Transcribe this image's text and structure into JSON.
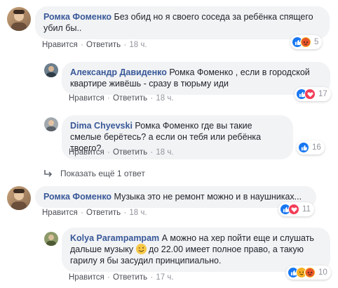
{
  "comments": [
    {
      "author": "Ромка Фоменко",
      "text": " Без обид но я своего соседа за ребёнка спящего убил бы..",
      "like": "Нравится",
      "reply": "Ответить",
      "time": "18 ч.",
      "reactions": {
        "icons": [
          "like-icon",
          "angry-icon"
        ],
        "count": "5"
      }
    },
    {
      "author": "Александр Давиденко",
      "text": " Ромка Фоменко , если в городской квартире живёшь - сразу в тюрьму иди",
      "like": "Нравится",
      "reply": "Ответить",
      "time": "18 ч.",
      "reactions": {
        "icons": [
          "like-icon",
          "love-icon"
        ],
        "count": "17"
      }
    },
    {
      "author": "Dima Chyevski",
      "text": " Ромка Фоменко где вы такие смелые берётесь? а если он тебя или ребёнка твоего?",
      "like": "Нравится",
      "reply": "Ответить",
      "time": "18 ч.",
      "reactions": {
        "icons": [
          "like-icon"
        ],
        "count": "16"
      }
    },
    {
      "author": "Ромка Фоменко",
      "text": " Музыка это не ремонт можно и в наушниках...",
      "like": "Нравится",
      "reply": "Ответить",
      "time": "18 ч.",
      "reactions": {
        "icons": [
          "like-icon",
          "love-icon"
        ],
        "count": "11"
      }
    },
    {
      "author": "Kolya Parampampam",
      "text_part1": " А можно на хер пойти еще и слушать дальше музыку ",
      "text_part2": " до 22.00 имеет полное право, а такую гарилу я бы засудил принципиально.",
      "like": "Нравится",
      "reply": "Ответить",
      "time": "17 ч.",
      "reactions": {
        "icons": [
          "like-icon",
          "haha-icon",
          "angry-icon"
        ],
        "count": "10"
      }
    }
  ],
  "more_replies": {
    "icon": "reply-arrow-icon",
    "label": "Показать ещё 1 ответ"
  },
  "colors": {
    "author": "#385898",
    "bubble": "#f2f3f5",
    "meta": "#90949c",
    "like": "#1877f2",
    "love": "#f33e58",
    "angry": "#f7b125"
  }
}
